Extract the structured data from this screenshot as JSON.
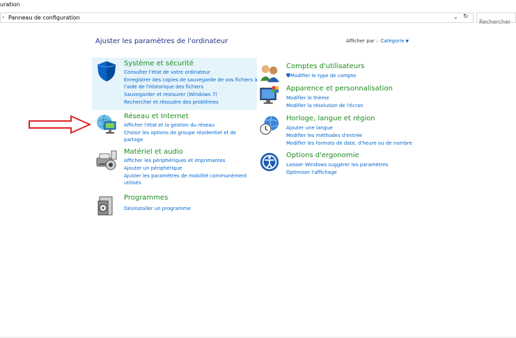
{
  "window": {
    "title": "uration"
  },
  "address": {
    "separator": "›",
    "breadcrumb": "Panneau de configuration",
    "dropdown_glyph": "⌄",
    "refresh_glyph": "↻"
  },
  "search": {
    "placeholder": "Rechercher"
  },
  "header": {
    "title": "Ajuster les paramètres de l'ordinateur",
    "view_by_label": "Afficher par :",
    "view_by_value": "Catégorie"
  },
  "categories": [
    {
      "title": "Système et sécurité",
      "icon": "shield-icon",
      "links": [
        "Consulter l'état de votre ordinateur",
        "Enregistrer des copies de sauvegarde de vos fichiers à",
        "l'aide de l'Historique des fichiers",
        "Sauvegarder et restaurer (Windows 7)",
        "Rechercher et résoudre des problèmes"
      ]
    },
    {
      "title": "Réseau et Internet",
      "icon": "network-icon",
      "links": [
        "Afficher l'état et la gestion du réseau",
        "Choisir les options de groupe résidentiel et de",
        "partage"
      ]
    },
    {
      "title": "Matériel et audio",
      "icon": "hardware-sound-icon",
      "links": [
        "Afficher les périphériques et imprimantes",
        "Ajouter un périphérique",
        "Ajuster les paramètres de mobilité communément",
        "utilisés"
      ]
    },
    {
      "title": "Programmes",
      "icon": "programs-icon",
      "links": [
        "Désinstaller un programme"
      ]
    },
    {
      "title": "Comptes d'utilisateurs",
      "icon": "users-icon",
      "links": [
        "Modifier le type de compte"
      ]
    },
    {
      "title": "Apparence et personnalisation",
      "icon": "appearance-icon",
      "links": [
        "Modifier le thème",
        "Modifier la résolution de l'écran"
      ]
    },
    {
      "title": "Horloge, langue et région",
      "icon": "clock-globe-icon",
      "links": [
        "Ajouter une langue",
        "Modifier les méthodes d'entrée",
        "Modifier les formats de date, d'heure ou de nombre"
      ]
    },
    {
      "title": "Options d'ergonomie",
      "icon": "ease-of-access-icon",
      "links": [
        "Laisser Windows suggérer les paramètres",
        "Optimiser l'affichage"
      ]
    }
  ],
  "annotation": {
    "arrow_color": "#e02020"
  }
}
